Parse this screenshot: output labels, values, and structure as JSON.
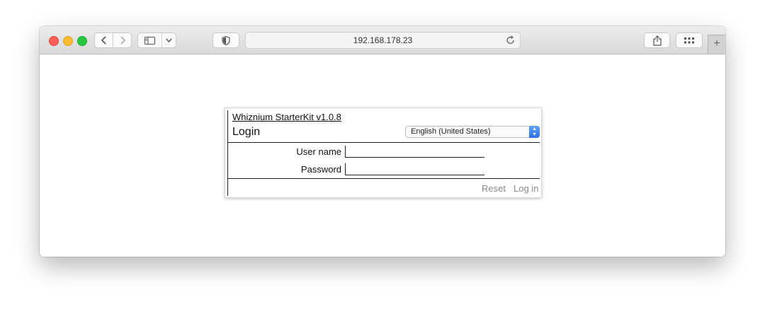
{
  "browser": {
    "url": "192.168.178.23",
    "icons": {
      "back": "chevron-left-icon",
      "forward": "chevron-right-icon",
      "sidebar": "sidebar-icon",
      "privacy": "shield-icon",
      "reload": "reload-icon",
      "share": "share-icon",
      "tabs": "tab-overview-icon",
      "newtab": "plus-icon"
    }
  },
  "login": {
    "app_title": "Whiznium StarterKit v1.0.8",
    "heading": "Login",
    "language": "English (United States)",
    "username_label": "User name",
    "username_value": "",
    "password_label": "Password",
    "password_value": "",
    "reset_label": "Reset",
    "login_label": "Log in"
  },
  "colors": {
    "traffic_red": "#fe5f57",
    "traffic_yellow": "#febc2e",
    "traffic_green": "#28c840",
    "select_accent": "#2c6fe5",
    "action_text": "#8a8a8a"
  }
}
